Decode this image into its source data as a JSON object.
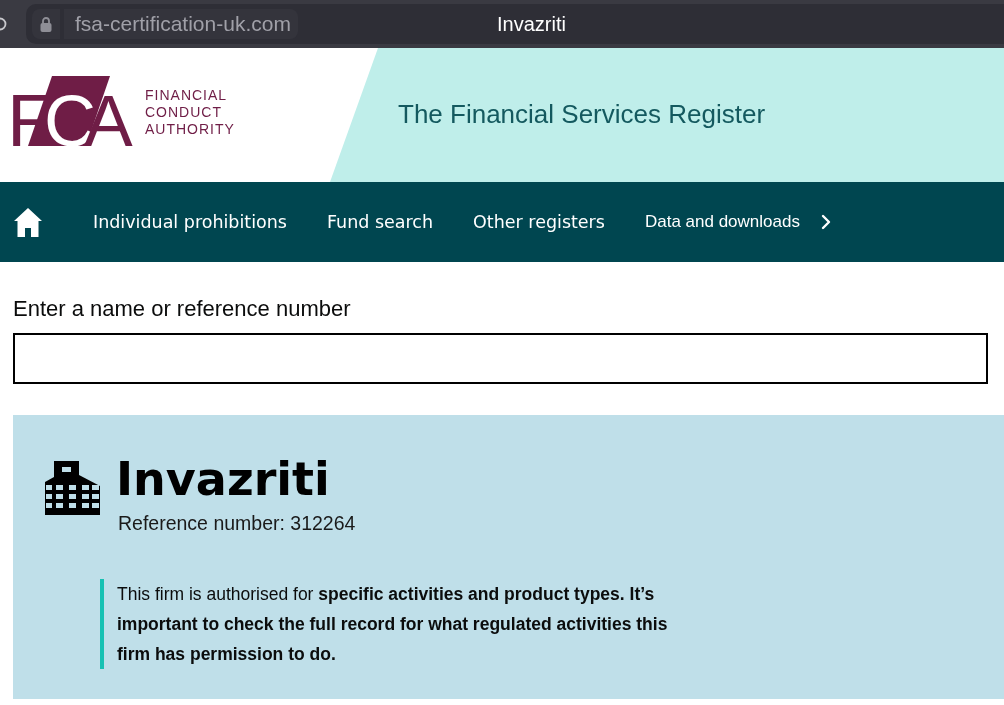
{
  "browser": {
    "url": "fsa-certification-uk.com",
    "page_title": "Invazriti"
  },
  "header": {
    "logo": {
      "mark_letters": [
        "F",
        "C",
        "A"
      ],
      "wordmark": [
        "FINANCIAL",
        "CONDUCT",
        "AUTHORITY"
      ]
    },
    "title": "The Financial Services Register"
  },
  "nav": {
    "items": [
      "Individual prohibitions",
      "Fund search",
      "Other registers",
      "Data and downloads"
    ]
  },
  "search": {
    "label": "Enter a name or reference number"
  },
  "firm": {
    "name": "Invazriti",
    "reference": "Reference number: 312264",
    "notice": "This firm is authorised for **specific activities and product types. It’s important to check the full record for what regulated activities this firm has permission to do.**"
  }
}
